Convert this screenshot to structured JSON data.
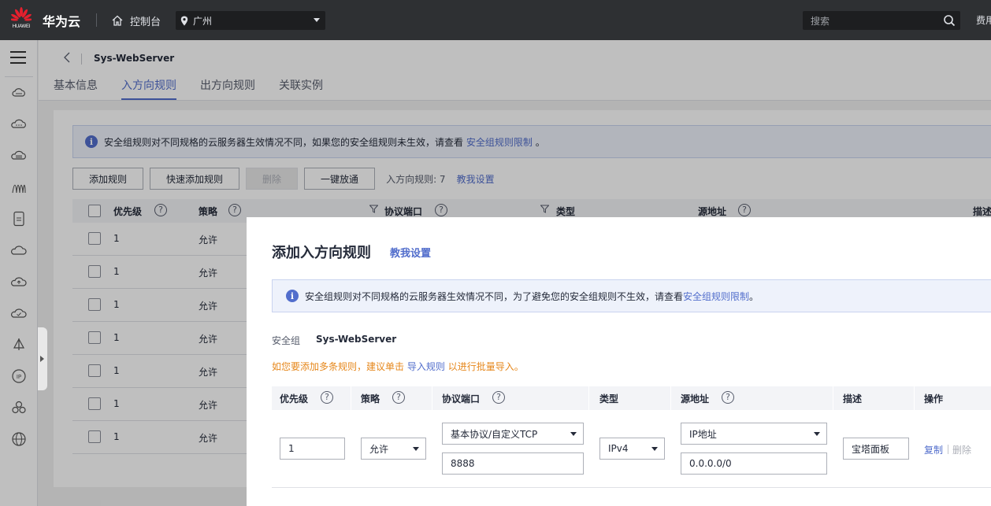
{
  "topbar": {
    "logo_text": "HUAWEI",
    "brand": "华为云",
    "console_label": "控制台",
    "region": "广州",
    "search_placeholder": "搜索",
    "fee_label": "费用"
  },
  "header": {
    "back_icon": "chevron-left-icon",
    "security_group_name": "Sys-WebServer",
    "tabs": [
      {
        "label": "基本信息",
        "active": false
      },
      {
        "label": "入方向规则",
        "active": true
      },
      {
        "label": "出方向规则",
        "active": false
      },
      {
        "label": "关联实例",
        "active": false
      }
    ]
  },
  "panel": {
    "notice_text": "安全组规则对不同规格的云服务器生效情况不同，如果您的安全组规则未生效，请查看",
    "notice_link": "安全组规则限制",
    "notice_end": "。",
    "buttons": {
      "add_rule": "添加规则",
      "quick_add": "快速添加规则",
      "delete": "删除",
      "one_click": "一键放通"
    },
    "rules_count": "入方向规则: 7",
    "teach_link": "教我设置",
    "table_headers": {
      "priority": "优先级",
      "policy": "策略",
      "protocol_port": "协议端口",
      "type": "类型",
      "source": "源地址",
      "description": "描述"
    },
    "rows": [
      {
        "priority": "1",
        "policy": "允许"
      },
      {
        "priority": "1",
        "policy": "允许"
      },
      {
        "priority": "1",
        "policy": "允许"
      },
      {
        "priority": "1",
        "policy": "允许"
      },
      {
        "priority": "1",
        "policy": "允许"
      },
      {
        "priority": "1",
        "policy": "允许"
      },
      {
        "priority": "1",
        "policy": "允许"
      }
    ]
  },
  "modal": {
    "title": "添加入方向规则",
    "teach_link": "教我设置",
    "notice_text": "安全组规则对不同规格的云服务器生效情况不同，为了避免您的安全组规则不生效，请查看",
    "notice_link": "安全组规则限制",
    "notice_end": "。",
    "sg_label": "安全组",
    "sg_value": "Sys-WebServer",
    "tip_prefix": "如您要添加多条规则，建议单击",
    "tip_link": "导入规则",
    "tip_suffix": "以进行批量导入。",
    "headers": {
      "priority": "优先级",
      "policy": "策略",
      "protocol_port": "协议端口",
      "type": "类型",
      "source": "源地址",
      "description": "描述",
      "operation": "操作"
    },
    "row": {
      "priority": "1",
      "policy": "允许",
      "protocol": "基本协议/自定义TCP",
      "port": "8888",
      "type": "IPv4",
      "source_type": "IP地址",
      "source_ip": "0.0.0.0/0",
      "description": "宝塔面板",
      "copy": "复制",
      "delete": "删除"
    }
  }
}
